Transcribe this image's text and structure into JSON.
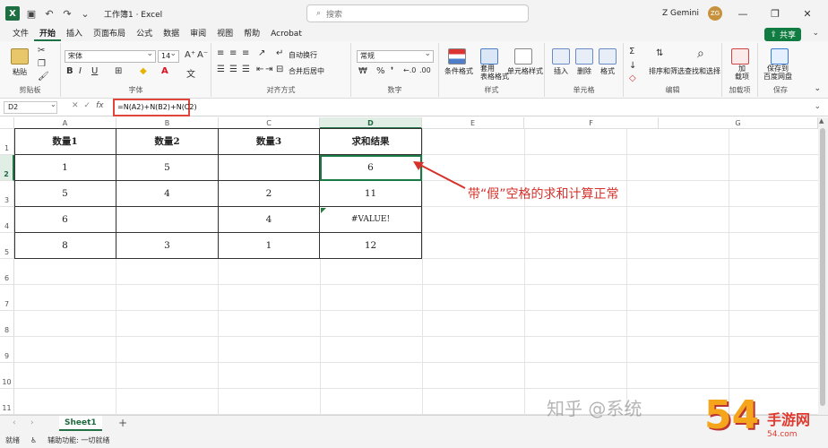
{
  "titlebar": {
    "logo": "X",
    "doc_title": "工作簿1 · Excel",
    "search_placeholder": "搜索",
    "user_name": "Z Gemini",
    "user_initials": "ZG",
    "icons": [
      "save-icon",
      "undo-icon",
      "redo-icon",
      "customize-icon",
      "minimize-icon",
      "restore-icon",
      "close-icon"
    ]
  },
  "menu": {
    "tabs": [
      "文件",
      "开始",
      "插入",
      "页面布局",
      "公式",
      "数据",
      "审阅",
      "视图",
      "帮助",
      "Acrobat"
    ],
    "active_tab": "开始",
    "share_label": "共享"
  },
  "ribbon": {
    "paste_label": "粘贴",
    "clipboard_label": "剪贴板",
    "font_name": "宋体",
    "font_size": "14",
    "bold": "B",
    "italic": "I",
    "underline": "U",
    "font_label": "字体",
    "wrap_text": "自动换行",
    "merge_center": "合并后居中",
    "align_label": "对齐方式",
    "number_format": "常规",
    "number_label": "数字",
    "cond_format": "条件格式",
    "table_format": "套用\n表格格式",
    "cell_style": "单元格样式",
    "styles_label": "样式",
    "insert": "插入",
    "delete": "删除",
    "format": "格式",
    "cells_label": "单元格",
    "sort_filter": "排序和筛选",
    "find_select": "查找和选择",
    "edit_label": "编辑",
    "addins": "加\n载项",
    "addins_label": "加载项",
    "save_baidu": "保存到\n百度网盘",
    "save_label": "保存"
  },
  "formula_bar": {
    "name_box": "D2",
    "formula": "=N(A2)+N(B2)+N(C2)"
  },
  "columns": [
    "A",
    "B",
    "C",
    "D",
    "E",
    "F",
    "G"
  ],
  "selected_column": "D",
  "rows": [
    "1",
    "2",
    "3",
    "4",
    "5",
    "6",
    "7",
    "8",
    "9",
    "10",
    "11"
  ],
  "selected_row": "2",
  "table": {
    "headers": [
      "数量1",
      "数量2",
      "数量3",
      "求和结果"
    ],
    "data": [
      [
        "1",
        "5",
        "",
        "6"
      ],
      [
        "5",
        "4",
        "2",
        "11"
      ],
      [
        "6",
        "",
        "4",
        "#VALUE!"
      ],
      [
        "8",
        "3",
        "1",
        "12"
      ]
    ]
  },
  "annotation": "带“假”空格的求和计算正常",
  "annotation_color": "#d6322b",
  "sheet_tab": "Sheet1",
  "status": {
    "ready": "就绪",
    "accessibility": "辅助功能: 一切就绪"
  },
  "watermark": "知乎 @系统",
  "logo_watermark": {
    "big": "54",
    "small": "手游网",
    "url": "54.com"
  }
}
